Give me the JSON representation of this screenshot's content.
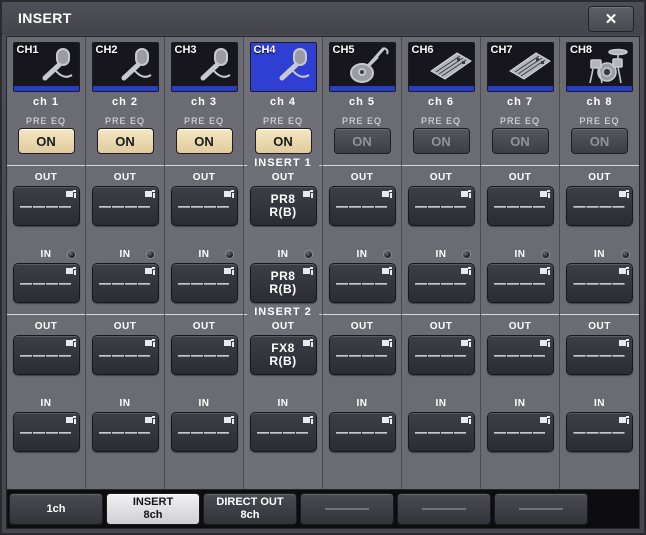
{
  "window": {
    "title": "INSERT",
    "close_label": "✕"
  },
  "colors": {
    "panel_bg": "#3c3c44",
    "strip_bg": "#6b6b73",
    "selected_blue": "#2f3fd4",
    "underline_blue": "#2b3cc8",
    "on_active": "#e8d3a3",
    "on_inactive": "#4a4a52",
    "tab_selected": "#e2e2e6"
  },
  "groups": {
    "insert1_label": "INSERT 1",
    "insert2_label": "INSERT 2",
    "out_label": "OUT",
    "in_label": "IN"
  },
  "channels": [
    {
      "number": "CH1",
      "name": "ch 1",
      "icon": "microphone-icon",
      "selected": false,
      "pre_eq_label": "PRE EQ",
      "on_label": "ON",
      "on_active": true,
      "insert1": {
        "out": {
          "line1": "————",
          "line2": ""
        },
        "in": {
          "line1": "————",
          "line2": ""
        },
        "in_led": true
      },
      "insert2": {
        "out": {
          "line1": "————",
          "line2": ""
        },
        "in": {
          "line1": "————",
          "line2": ""
        },
        "in_led": false
      }
    },
    {
      "number": "CH2",
      "name": "ch 2",
      "icon": "microphone-icon",
      "selected": false,
      "pre_eq_label": "PRE EQ",
      "on_label": "ON",
      "on_active": true,
      "insert1": {
        "out": {
          "line1": "————",
          "line2": ""
        },
        "in": {
          "line1": "————",
          "line2": ""
        },
        "in_led": true
      },
      "insert2": {
        "out": {
          "line1": "————",
          "line2": ""
        },
        "in": {
          "line1": "————",
          "line2": ""
        },
        "in_led": false
      }
    },
    {
      "number": "CH3",
      "name": "ch 3",
      "icon": "microphone-icon",
      "selected": false,
      "pre_eq_label": "PRE EQ",
      "on_label": "ON",
      "on_active": true,
      "insert1": {
        "out": {
          "line1": "————",
          "line2": ""
        },
        "in": {
          "line1": "————",
          "line2": ""
        },
        "in_led": true
      },
      "insert2": {
        "out": {
          "line1": "————",
          "line2": ""
        },
        "in": {
          "line1": "————",
          "line2": ""
        },
        "in_led": false
      }
    },
    {
      "number": "CH4",
      "name": "ch 4",
      "icon": "microphone-icon",
      "selected": true,
      "pre_eq_label": "PRE EQ",
      "on_label": "ON",
      "on_active": true,
      "insert1": {
        "out": {
          "line1": "PR8",
          "line2": "R(B)"
        },
        "in": {
          "line1": "PR8",
          "line2": "R(B)"
        },
        "in_led": true
      },
      "insert2": {
        "out": {
          "line1": "FX8",
          "line2": "R(B)"
        },
        "in": {
          "line1": "————",
          "line2": ""
        },
        "in_led": false
      }
    },
    {
      "number": "CH5",
      "name": "ch 5",
      "icon": "guitar-icon",
      "selected": false,
      "pre_eq_label": "PRE EQ",
      "on_label": "ON",
      "on_active": false,
      "insert1": {
        "out": {
          "line1": "————",
          "line2": ""
        },
        "in": {
          "line1": "————",
          "line2": ""
        },
        "in_led": true
      },
      "insert2": {
        "out": {
          "line1": "————",
          "line2": ""
        },
        "in": {
          "line1": "————",
          "line2": ""
        },
        "in_led": false
      }
    },
    {
      "number": "CH6",
      "name": "ch 6",
      "icon": "keyboard-icon",
      "selected": false,
      "pre_eq_label": "PRE EQ",
      "on_label": "ON",
      "on_active": false,
      "insert1": {
        "out": {
          "line1": "————",
          "line2": ""
        },
        "in": {
          "line1": "————",
          "line2": ""
        },
        "in_led": true
      },
      "insert2": {
        "out": {
          "line1": "————",
          "line2": ""
        },
        "in": {
          "line1": "————",
          "line2": ""
        },
        "in_led": false
      }
    },
    {
      "number": "CH7",
      "name": "ch 7",
      "icon": "keyboard-icon",
      "selected": false,
      "pre_eq_label": "PRE EQ",
      "on_label": "ON",
      "on_active": false,
      "insert1": {
        "out": {
          "line1": "————",
          "line2": ""
        },
        "in": {
          "line1": "————",
          "line2": ""
        },
        "in_led": true
      },
      "insert2": {
        "out": {
          "line1": "————",
          "line2": ""
        },
        "in": {
          "line1": "————",
          "line2": ""
        },
        "in_led": false
      }
    },
    {
      "number": "CH8",
      "name": "ch 8",
      "icon": "drums-icon",
      "selected": false,
      "pre_eq_label": "PRE EQ",
      "on_label": "ON",
      "on_active": false,
      "insert1": {
        "out": {
          "line1": "————",
          "line2": ""
        },
        "in": {
          "line1": "————",
          "line2": ""
        },
        "in_led": true
      },
      "insert2": {
        "out": {
          "line1": "————",
          "line2": ""
        },
        "in": {
          "line1": "————",
          "line2": ""
        },
        "in_led": false
      }
    }
  ],
  "tabs": [
    {
      "line1": "1ch",
      "line2": "",
      "selected": false
    },
    {
      "line1": "INSERT",
      "line2": "8ch",
      "selected": true
    },
    {
      "line1": "DIRECT OUT",
      "line2": "8ch",
      "selected": false
    },
    {
      "line1": "————",
      "line2": "",
      "selected": false
    },
    {
      "line1": "————",
      "line2": "",
      "selected": false
    },
    {
      "line1": "————",
      "line2": "",
      "selected": false
    }
  ]
}
